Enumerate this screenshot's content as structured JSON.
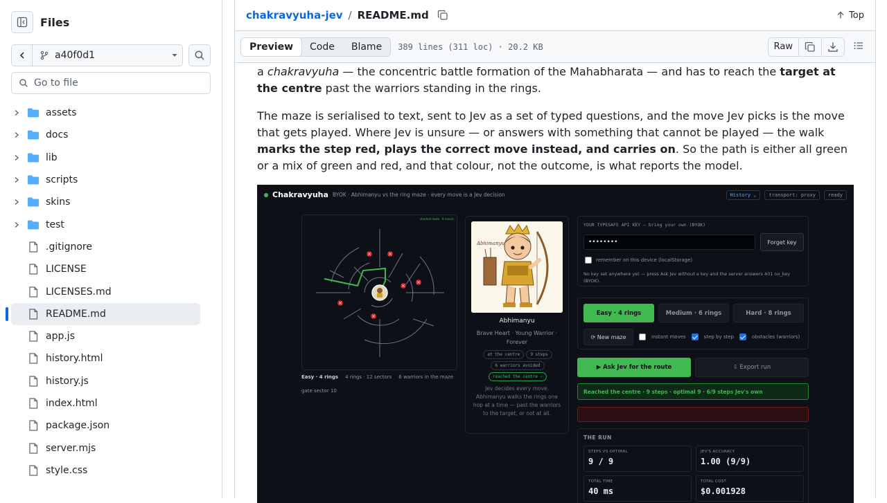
{
  "sidebar": {
    "title": "Files",
    "branch": "a40f0d1",
    "goto_placeholder": "Go to file",
    "items": [
      {
        "type": "dir",
        "label": "assets"
      },
      {
        "type": "dir",
        "label": "docs"
      },
      {
        "type": "dir",
        "label": "lib"
      },
      {
        "type": "dir",
        "label": "scripts"
      },
      {
        "type": "dir",
        "label": "skins"
      },
      {
        "type": "dir",
        "label": "test"
      },
      {
        "type": "file",
        "label": ".gitignore"
      },
      {
        "type": "file",
        "label": "LICENSE"
      },
      {
        "type": "file",
        "label": "LICENSES.md"
      },
      {
        "type": "file",
        "label": "README.md",
        "active": true
      },
      {
        "type": "file",
        "label": "app.js"
      },
      {
        "type": "file",
        "label": "history.html"
      },
      {
        "type": "file",
        "label": "history.js"
      },
      {
        "type": "file",
        "label": "index.html"
      },
      {
        "type": "file",
        "label": "package.json"
      },
      {
        "type": "file",
        "label": "server.mjs"
      },
      {
        "type": "file",
        "label": "style.css"
      }
    ]
  },
  "header": {
    "repo": "chakravyuha-jev",
    "sep": "/",
    "file": "README.md",
    "top": "Top"
  },
  "toolbar": {
    "tabs": [
      "Preview",
      "Code",
      "Blame"
    ],
    "meta": "389 lines (311 loc) · 20.2 KB",
    "raw": "Raw"
  },
  "readme": {
    "p1": {
      "a": "a ",
      "b": "chakravyuha",
      "c": " — the concentric battle formation of the Mahabharata — and has to reach the ",
      "d": "target at the centre",
      "e": " past the warriors standing in the rings."
    },
    "p2": {
      "a": "The maze is serialised to text, sent to Jev as a set of typed questions, and the move Jev picks is the move that gets played. Where Jev is unsure — or answers with something that cannot be played — the walk ",
      "b": "marks the step red, plays the correct move instead, and carries on",
      "c": ". So the path is either all green or a mix of green and red, and that colour, not the outcome, is what reports the model."
    }
  },
  "shot": {
    "title": "Chakravyuha",
    "sub": "BYOK · Abhimanyu vs the ring maze · every move is a Jev decision",
    "chips": [
      "History ⌄",
      "transport: proxy",
      "ready"
    ],
    "maze_legend": "shortest route · 9 moves",
    "maze_caption": {
      "diff": "Easy · 4 rings",
      "rings": "4 rings · 12 sectors",
      "warriors": "6 warriors in the maze"
    },
    "gate": "gate sector 10",
    "hero": {
      "name": "Abhimanyu",
      "tagline": "Brave Heart · Young Warrior · Forever",
      "pills": [
        "at the centre",
        "9 steps",
        "6 warriors avoided",
        "reached the centre ✓"
      ],
      "desc": "Jev decides every move. Abhimanyu walks the rings one hop at a time — past the warriors to the target, or not at all.",
      "art_label": "Abhimanyu"
    },
    "key": {
      "label": "YOUR TYPESAFE API KEY — bring your own (BYOK)",
      "value": "••••••••",
      "forget": "Forget key",
      "remember": "remember on this device (localStorage)",
      "note": "No key set anywhere yet — press Ask Jev without a key and the server answers 401 no_key (BYOK)."
    },
    "difficulty": [
      "Easy · 4 rings",
      "Medium · 6 rings",
      "Hard · 8 rings"
    ],
    "options": {
      "new": "⟳ New maze",
      "instant": "instant moves",
      "step": "step by step",
      "obstacles": "obstacles (warriors)"
    },
    "ask": "▶ Ask Jev for the route",
    "export": "⇩ Export run",
    "result": "Reached the centre · 9 steps · optimal 9 · 6/9 steps Jev's own",
    "run": {
      "heading": "THE RUN",
      "stats": [
        {
          "k": "STEPS VS OPTIMAL",
          "v": "9 / 9"
        },
        {
          "k": "JEV'S ACCURACY",
          "v": "1.00 (9/9)"
        },
        {
          "k": "TOTAL TIME",
          "v": "40 ms"
        },
        {
          "k": "TOTAL COST",
          "v": "$0.001928"
        }
      ]
    }
  },
  "colors": {
    "link": "#0969da",
    "accent": "#3fb950",
    "danger": "#f85149"
  }
}
